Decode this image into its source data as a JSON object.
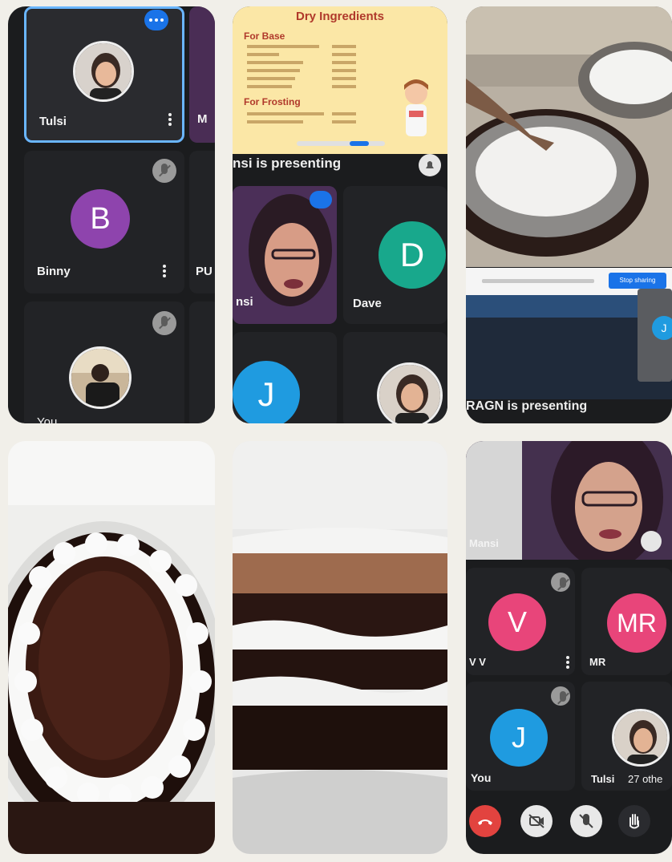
{
  "panel1": {
    "tiles": [
      {
        "name": "Tulsi",
        "partial": "M"
      },
      {
        "name": "Binny",
        "initial": "B",
        "partial": "PU"
      },
      {
        "name": "You"
      }
    ]
  },
  "panel2": {
    "slide": {
      "title": "Dry Ingredients",
      "section_base": "For Base",
      "section_frosting": "For Frosting"
    },
    "banner": "nsi is presenting",
    "tiles": [
      {
        "name": "nsi"
      },
      {
        "name": "Dave",
        "initial": "D"
      },
      {
        "initial": "J"
      }
    ]
  },
  "panel3": {
    "stop_btn": "Stop sharing",
    "thumb_initial": "J",
    "banner": "RAGN is presenting"
  },
  "panel6": {
    "presenter_name": "Mansi",
    "tiles": [
      {
        "name": "V V",
        "initial": "V"
      },
      {
        "name": "MR",
        "initial": "MR"
      },
      {
        "name": "You",
        "initial": "J"
      },
      {
        "name": "Tulsi",
        "extra": "27 othe"
      }
    ]
  },
  "colors": {
    "purple": "#8e44ad",
    "teal": "#18a88c",
    "blue": "#1f9be0",
    "pink": "#e8457a",
    "red": "#e2433f",
    "highlight": "#6ab6ff"
  }
}
